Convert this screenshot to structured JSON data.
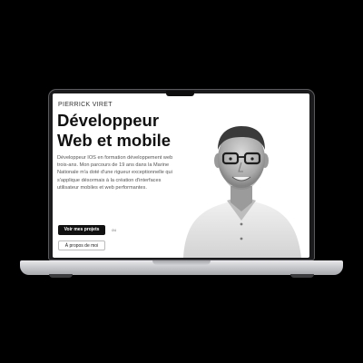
{
  "hero": {
    "name": "PIERRICK VIRET",
    "headline_line1": "Développeur",
    "headline_line2": "Web et mobile",
    "intro": "Développeur IOS en formation développement web trois-ans. Mon parcours de 19 ans dans la Marine Nationale m'a doté d'une rigueur exceptionnelle qui s'applique désormais à la création d'interfaces utilisateur mobiles et web performantes.",
    "primary_button": "Voir mes projets",
    "separator": "ou",
    "secondary_button": "À propos de moi"
  },
  "colors": {
    "screen_background": "#ffffff",
    "button_primary": "#111111",
    "laptop_body": "#c9cacd",
    "bezel": "#1b1b1d"
  },
  "icons": {
    "portrait": "person-photo"
  }
}
